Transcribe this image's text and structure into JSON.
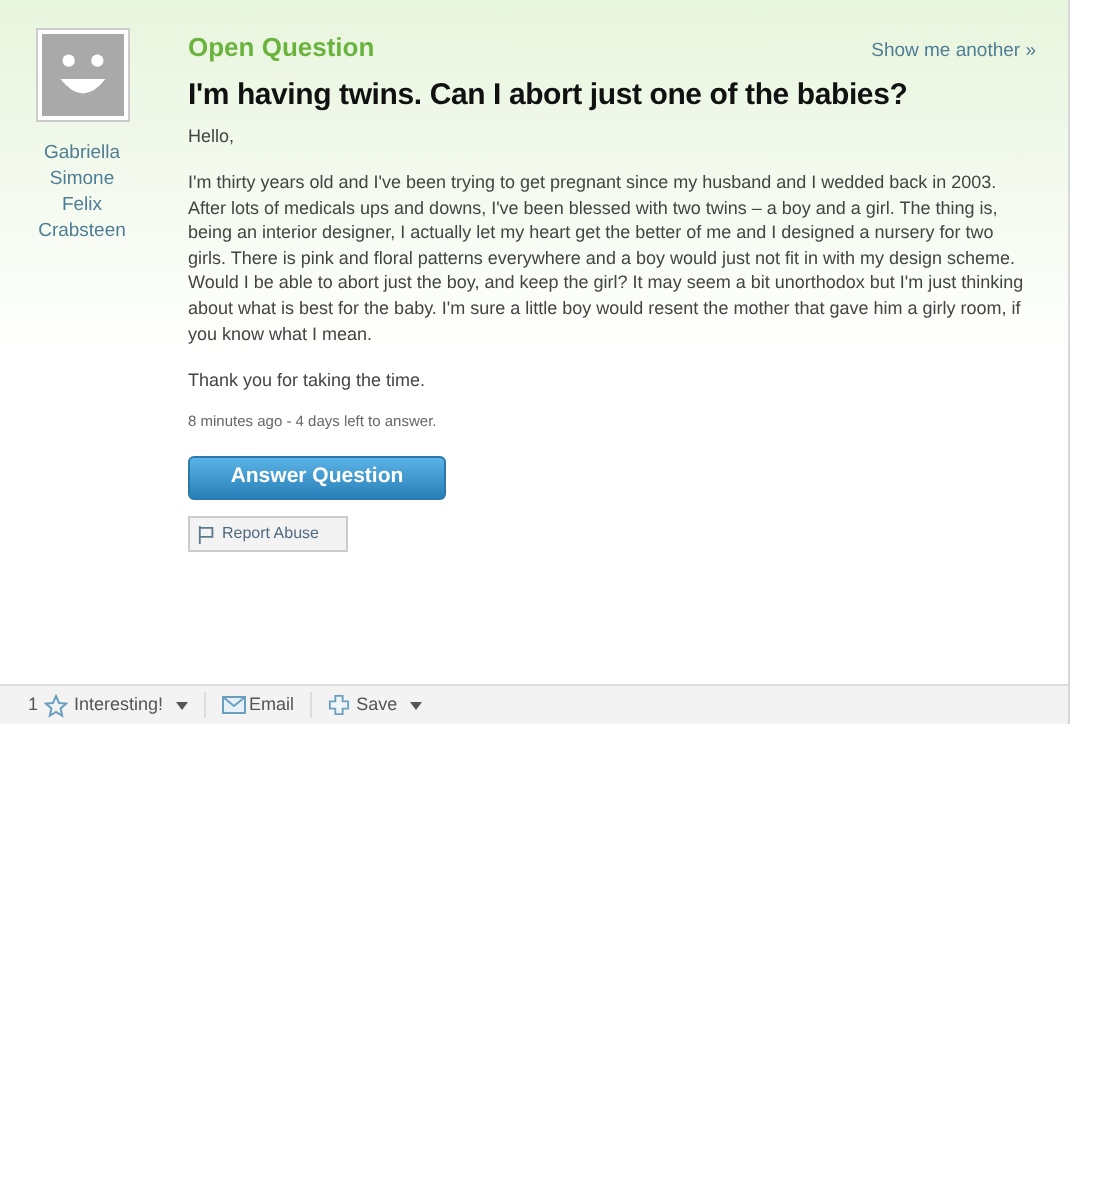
{
  "asker": {
    "name_lines": [
      "Gabriella",
      "Simone",
      "Felix",
      "Crabsteen"
    ]
  },
  "question": {
    "status": "Open Question",
    "show_another": "Show me another »",
    "title": "I'm having twins. Can I abort just one of the babies?",
    "paragraphs": [
      "Hello,",
      "I'm thirty years old and I've been trying to get pregnant since my husband and I wedded back in 2003. After lots of medicals ups and downs, I've been blessed with two twins – a boy and a girl. The thing is, being an interior designer, I actually let my heart get the better of me and I designed a nursery for two girls. There is pink and floral patterns everywhere and a boy would just not fit in with my design scheme. Would I be able to abort just the boy, and keep the girl? It may seem a bit unorthodox but I'm just thinking about what is best for the baby. I'm sure a little boy would resent the mother that gave him a girly room, if you know what I mean.",
      "Thank you for taking the time."
    ],
    "meta": "8 minutes ago - 4 days left to answer.",
    "answer_button": "Answer Question",
    "report_button": "Report Abuse"
  },
  "toolbar": {
    "interesting_count": "1",
    "interesting": "Interesting!",
    "email": "Email",
    "save": "Save"
  }
}
